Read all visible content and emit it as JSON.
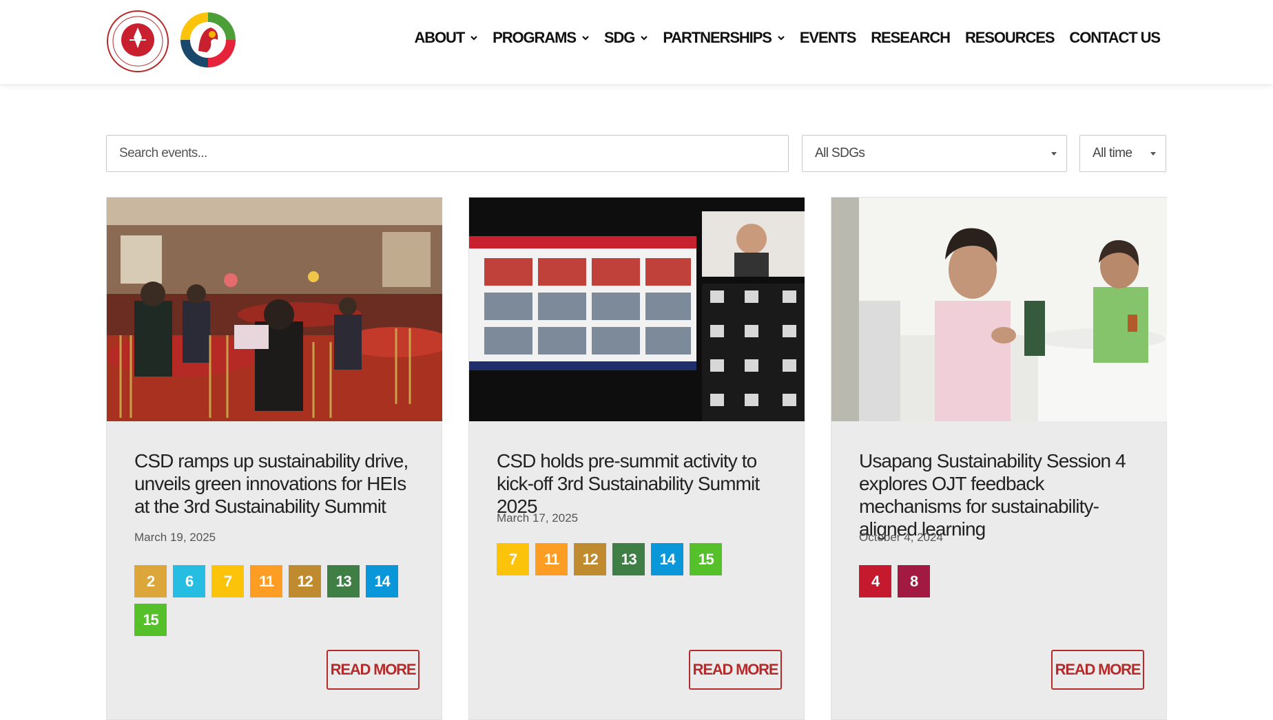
{
  "nav": {
    "items": [
      {
        "label": "ABOUT",
        "dropdown": true
      },
      {
        "label": "PROGRAMS",
        "dropdown": true
      },
      {
        "label": "SDG",
        "dropdown": true
      },
      {
        "label": "PARTNERSHIPS",
        "dropdown": true
      },
      {
        "label": "EVENTS",
        "dropdown": false
      },
      {
        "label": "RESEARCH",
        "dropdown": false
      },
      {
        "label": "RESOURCES",
        "dropdown": false
      },
      {
        "label": "CONTACT US",
        "dropdown": false
      }
    ]
  },
  "filters": {
    "search_placeholder": "Search events...",
    "sdg_select": "All SDGs",
    "time_select": "All time"
  },
  "colors": {
    "accent": "#b52a2a",
    "card_bg": "#ebebeb",
    "sdg": {
      "2": "#dda63a",
      "4": "#c5192d",
      "6": "#26bde2",
      "7": "#fcc30b",
      "8": "#a21942",
      "11": "#fd9d24",
      "12": "#bf8b2e",
      "13": "#3f7e44",
      "14": "#0a97d9",
      "15": "#56c02b"
    }
  },
  "cards": [
    {
      "title": "CSD ramps up sustainability drive, unveils green innovations for HEIs at the 3rd Sustainability Summit",
      "date": "March 19, 2025",
      "sdgs": [
        "2",
        "6",
        "7",
        "11",
        "12",
        "13",
        "14",
        "15"
      ],
      "read_more": "READ MORE"
    },
    {
      "title": "CSD holds pre-summit activity to kick-off 3rd Sustainability Summit 2025",
      "date": "March 17, 2025",
      "sdgs": [
        "7",
        "11",
        "12",
        "13",
        "14",
        "15"
      ],
      "read_more": "READ MORE"
    },
    {
      "title": "Usapang Sustainability Session 4 explores OJT feedback mechanisms for sustainability-aligned learning",
      "date": "October 4, 2024",
      "sdgs": [
        "4",
        "8"
      ],
      "read_more": "READ MORE"
    }
  ]
}
